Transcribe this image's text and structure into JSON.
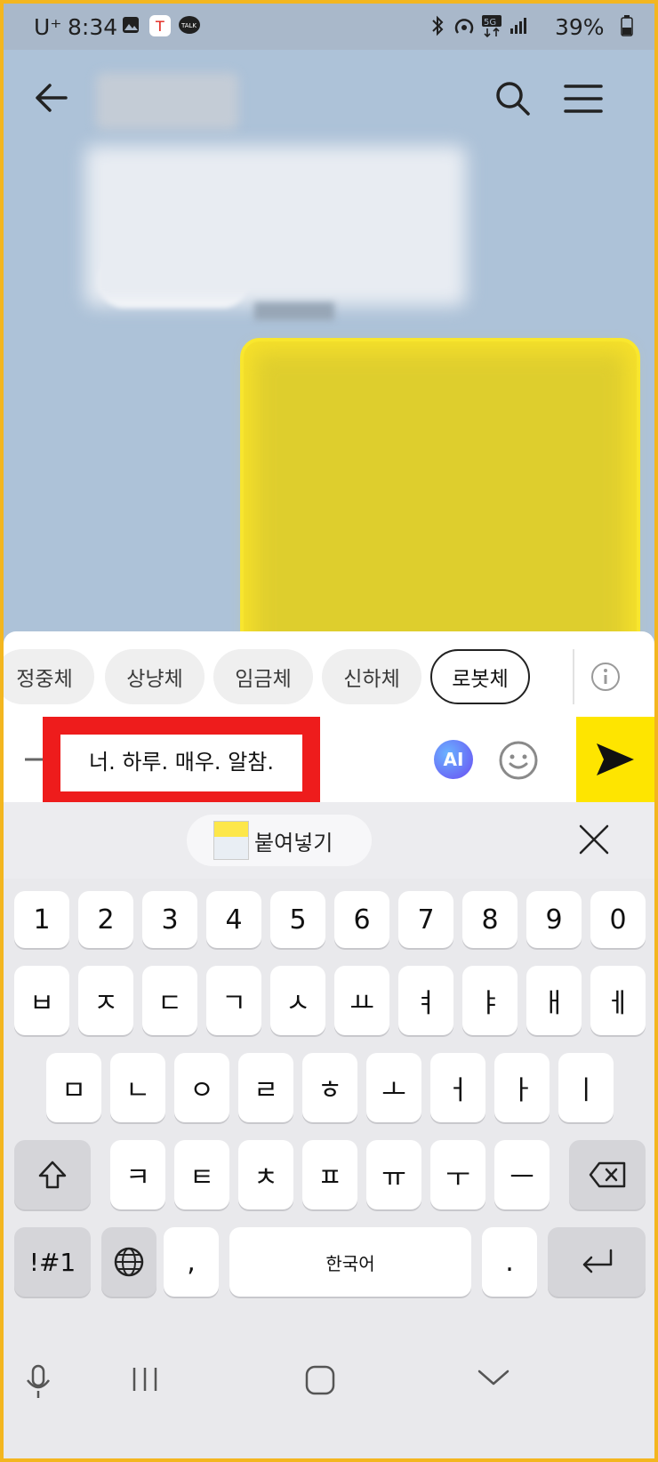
{
  "status_bar": {
    "carrier": "U⁺",
    "time": "8:34",
    "network": "5G",
    "battery": "39%"
  },
  "header": {
    "back_icon": "arrow-left-icon",
    "search_icon": "search-icon",
    "menu_icon": "hamburger-menu-icon"
  },
  "tone_chips": {
    "items": [
      {
        "label": "정중체"
      },
      {
        "label": "상냥체"
      },
      {
        "label": "임금체"
      },
      {
        "label": "신하체"
      },
      {
        "label": "로봇체"
      }
    ],
    "selected": "로봇체",
    "info_icon": "info-icon"
  },
  "composer": {
    "text": "너. 하루. 매우. 알참.",
    "ai_label": "AI",
    "emoji_icon": "smiley-icon",
    "send_icon": "send-arrow-icon",
    "highlight_color": "#ee1c1c",
    "send_color": "#fee500"
  },
  "clipboard": {
    "paste_label": "붙여넣기",
    "close_icon": "close-icon"
  },
  "keyboard": {
    "row_numbers": [
      "1",
      "2",
      "3",
      "4",
      "5",
      "6",
      "7",
      "8",
      "9",
      "0"
    ],
    "row1": [
      "ㅂ",
      "ㅈ",
      "ㄷ",
      "ㄱ",
      "ㅅ",
      "ㅛ",
      "ㅕ",
      "ㅑ",
      "ㅐ",
      "ㅔ"
    ],
    "row2": [
      "ㅁ",
      "ㄴ",
      "ㅇ",
      "ㄹ",
      "ㅎ",
      "ㅗ",
      "ㅓ",
      "ㅏ",
      "ㅣ"
    ],
    "row3": [
      "ㅋ",
      "ㅌ",
      "ㅊ",
      "ㅍ",
      "ㅠ",
      "ㅜ",
      "ㅡ"
    ],
    "symbols_label": "!#1",
    "comma_label": ",",
    "space_label": "한국어",
    "period_label": ".",
    "shift_icon": "shift-icon",
    "backspace_icon": "backspace-icon",
    "globe_icon": "globe-icon",
    "enter_icon": "enter-icon"
  },
  "nav_bar": {
    "mic_icon": "microphone-icon",
    "recents_icon": "recents-icon",
    "home_icon": "home-icon",
    "hide_keyboard_icon": "chevron-down-icon"
  }
}
